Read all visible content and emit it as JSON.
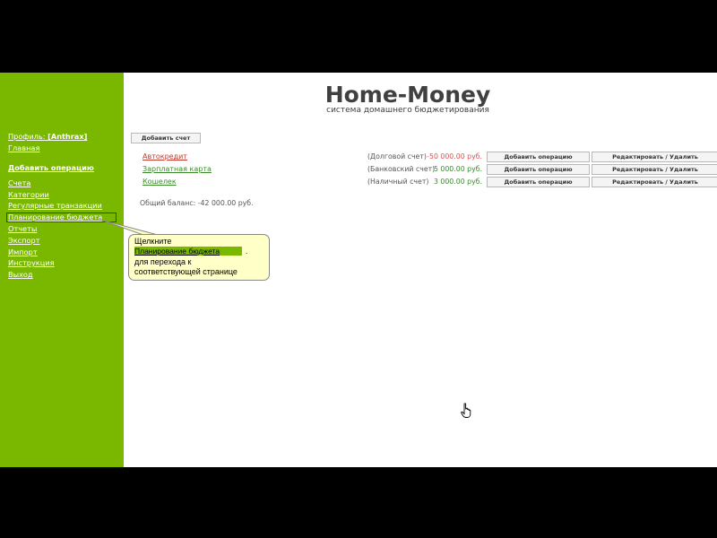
{
  "sidebar": {
    "profile_label": "Профиль: ",
    "profile_user": "[Anthrax]",
    "items": [
      {
        "label": "Главная"
      },
      {
        "label": "Добавить операцию"
      },
      {
        "label": "Счета"
      },
      {
        "label": "Категории"
      },
      {
        "label": "Регулярные транзакции"
      },
      {
        "label": "Планирование бюджета"
      },
      {
        "label": "Отчеты"
      },
      {
        "label": "Экспорт"
      },
      {
        "label": "Импорт"
      },
      {
        "label": "Инструкция"
      },
      {
        "label": "Выход"
      }
    ]
  },
  "brand": {
    "title": "Home-Money",
    "subtitle": "система домашнего бюджетирования"
  },
  "toolbar": {
    "add_account_label": "Добавить счет"
  },
  "accounts": [
    {
      "name": "Автокредит",
      "type": "(Долговой счет)",
      "amount": "-50 000.00 руб.",
      "add_op": "Добавить операцию",
      "edit": "Редактировать / Удалить",
      "name_color": "#c0392b",
      "amount_color": "#d9534f"
    },
    {
      "name": "Зарплатная карта",
      "type": "(Банковский счет)",
      "amount": "5 000.00 руб.",
      "add_op": "Добавить операцию",
      "edit": "Редактировать / Удалить",
      "name_color": "#3a8a2a",
      "amount_color": "#3a8a2a"
    },
    {
      "name": "Кошелек",
      "type": "(Наличный счет)",
      "amount": "3 000.00 руб.",
      "add_op": "Добавить операцию",
      "edit": "Редактировать / Удалить",
      "name_color": "#3a8a2a",
      "amount_color": "#3a8a2a"
    }
  ],
  "balance": "Общий баланс: -42 000.00 руб.",
  "tooltip": {
    "line1": "Щелкните",
    "link": "Планирование бюджета",
    "dot": ".",
    "line3": "для перехода к",
    "line4": "соответствующей странице"
  },
  "colors": {
    "sidebar_bg": "#7ab800",
    "highlight_border": "#d20000",
    "tooltip_bg": "#ffffc8"
  }
}
